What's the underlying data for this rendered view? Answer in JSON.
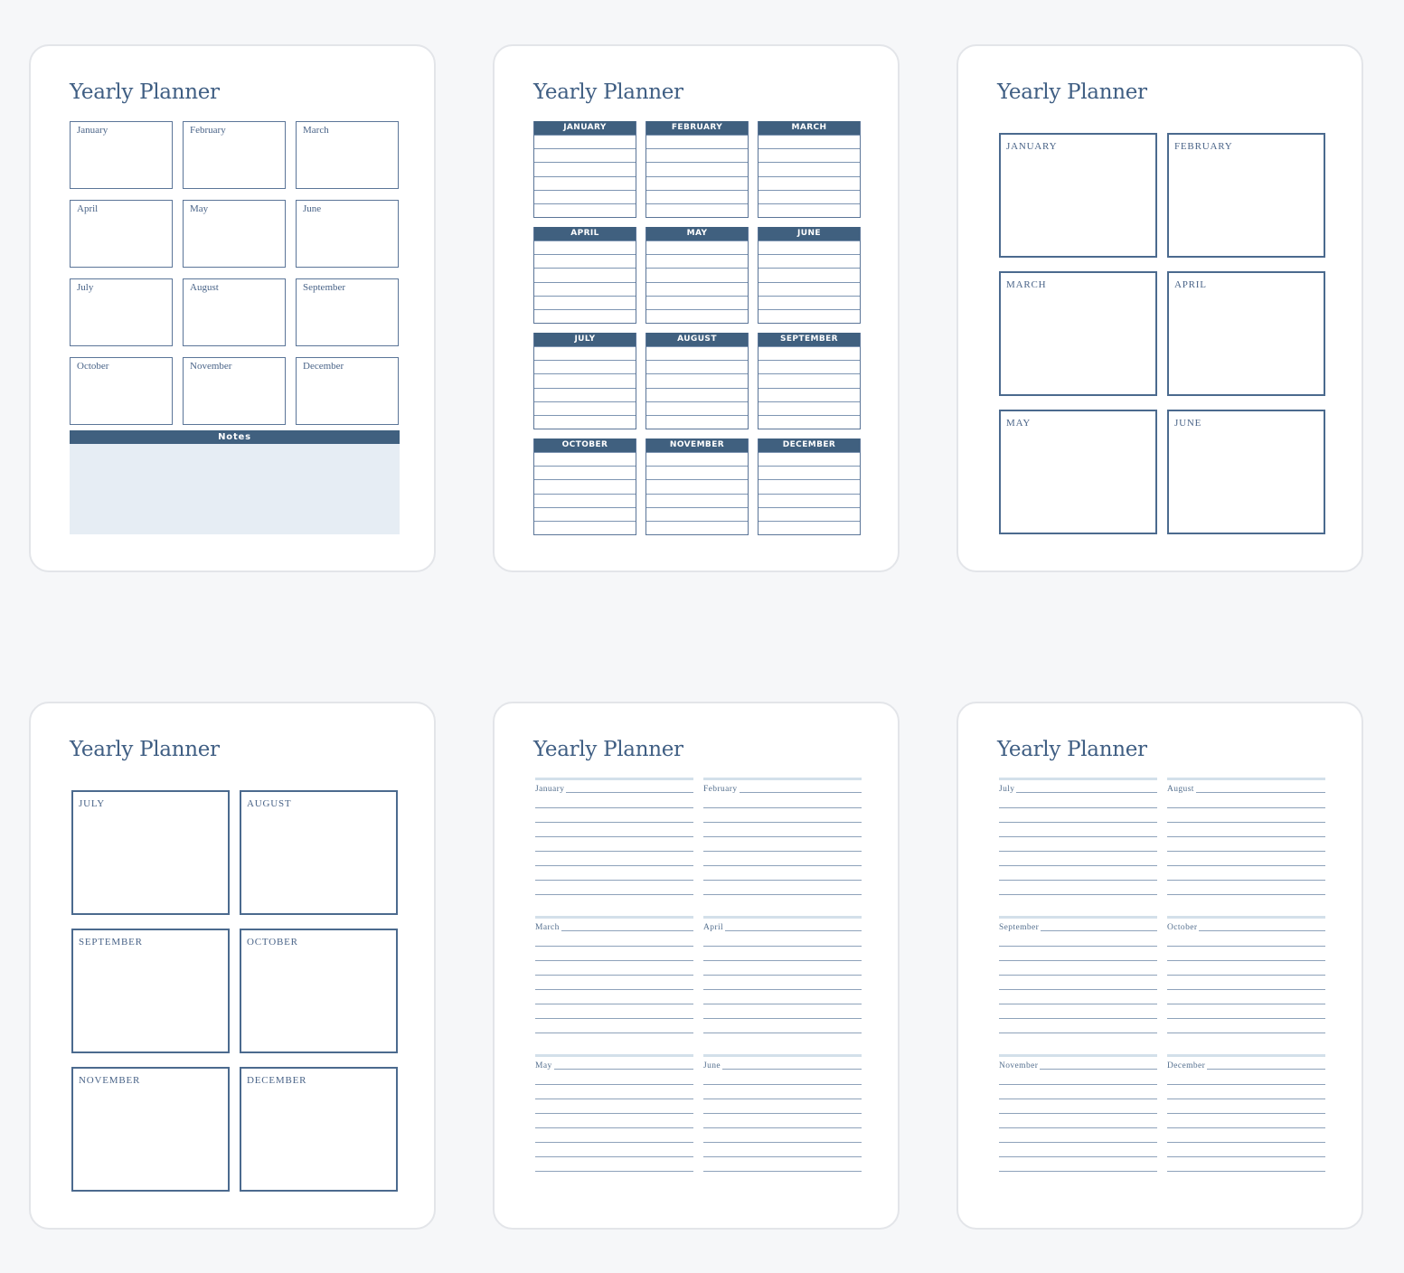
{
  "title": "Yearly Planner",
  "colors": {
    "accent": "#40607f",
    "border": "#5b7598",
    "notes_bg": "#e6edf4",
    "page_bg": "#f6f7f9"
  },
  "card1": {
    "months": [
      "January",
      "February",
      "March",
      "April",
      "May",
      "June",
      "July",
      "August",
      "September",
      "October",
      "November",
      "December"
    ],
    "notes_label": "Notes"
  },
  "card2": {
    "months": [
      "JANUARY",
      "FEBRUARY",
      "MARCH",
      "APRIL",
      "MAY",
      "JUNE",
      "JULY",
      "AUGUST",
      "SEPTEMBER",
      "OCTOBER",
      "NOVEMBER",
      "DECEMBER"
    ]
  },
  "card3": {
    "months": [
      "JANUARY",
      "FEBRUARY",
      "MARCH",
      "APRIL",
      "MAY",
      "JUNE"
    ]
  },
  "card4": {
    "months": [
      "JULY",
      "AUGUST",
      "SEPTEMBER",
      "OCTOBER",
      "NOVEMBER",
      "DECEMBER"
    ]
  },
  "card5": {
    "months": [
      "January",
      "February",
      "March",
      "April",
      "May",
      "June"
    ]
  },
  "card6": {
    "months": [
      "July",
      "August",
      "September",
      "October",
      "November",
      "December"
    ]
  }
}
